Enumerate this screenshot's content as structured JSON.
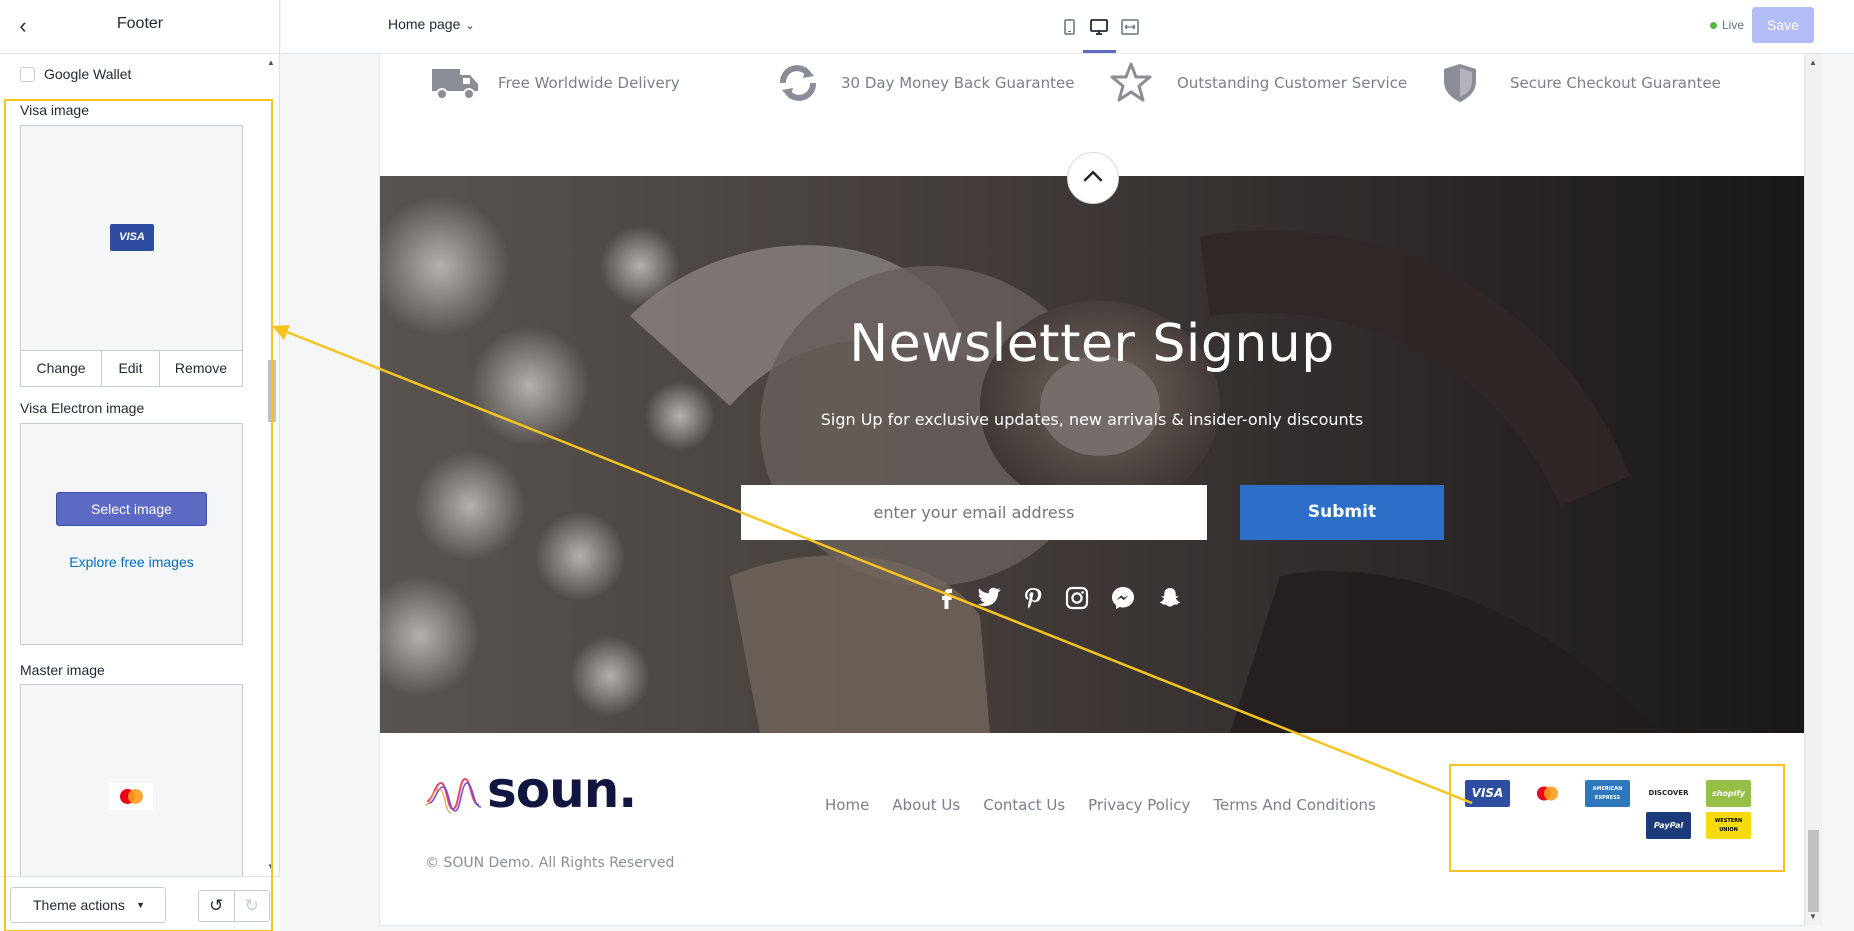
{
  "sidebar": {
    "title": "Footer",
    "checkbox_label": "Google Wallet",
    "visa": {
      "label": "Visa image",
      "badge": "VISA",
      "actions": [
        "Change",
        "Edit",
        "Remove"
      ]
    },
    "visa_electron": {
      "label": "Visa Electron image",
      "select_label": "Select image",
      "explore_label": "Explore free images"
    },
    "master": {
      "label": "Master image"
    },
    "theme_actions_label": "Theme actions"
  },
  "topbar": {
    "page_select": "Home page",
    "live_label": "Live",
    "save_label": "Save",
    "active_view": "desktop"
  },
  "preview": {
    "features": [
      {
        "icon": "truck-icon",
        "text": "Free Worldwide Delivery"
      },
      {
        "icon": "refresh-icon",
        "text": "30 Day Money Back Guarantee"
      },
      {
        "icon": "star-icon",
        "text": "Outstanding Customer Service"
      },
      {
        "icon": "shield-icon",
        "text": "Secure Checkout Guarantee"
      }
    ],
    "newsletter": {
      "title": "Newsletter Signup",
      "subtitle": "Sign Up for exclusive updates, new arrivals & insider-only discounts",
      "email_placeholder": "enter your email address",
      "submit_label": "Submit",
      "socials": [
        "facebook-icon",
        "twitter-icon",
        "pinterest-icon",
        "instagram-icon",
        "messenger-icon",
        "snapchat-icon"
      ]
    },
    "footer": {
      "logo_text": "soun.",
      "nav": [
        "Home",
        "About Us",
        "Contact Us",
        "Privacy Policy",
        "Terms And Conditions"
      ],
      "copyright": "© SOUN Demo. All Rights Reserved",
      "payments": [
        {
          "name": "visa",
          "label": "VISA",
          "color": "#2f4da0"
        },
        {
          "name": "mastercard",
          "label": "",
          "color": "#ffffff"
        },
        {
          "name": "amex",
          "label": "AMERICAN EXPRESS",
          "color": "#2e77bc"
        },
        {
          "name": "discover",
          "label": "DISCOVER",
          "color": "#ffffff"
        },
        {
          "name": "shopify",
          "label": "shopify",
          "color": "#95bf47"
        },
        {
          "name": "paypal",
          "label": "PayPal",
          "color": "#1a3a7a"
        },
        {
          "name": "western-union",
          "label": "WESTERN UNION",
          "color": "#f6d90f"
        }
      ]
    }
  },
  "colors": {
    "accent": "#5c6ac4",
    "annotation": "#f7c41f",
    "submit": "#2d6ec9",
    "brand_navy": "#101640"
  }
}
